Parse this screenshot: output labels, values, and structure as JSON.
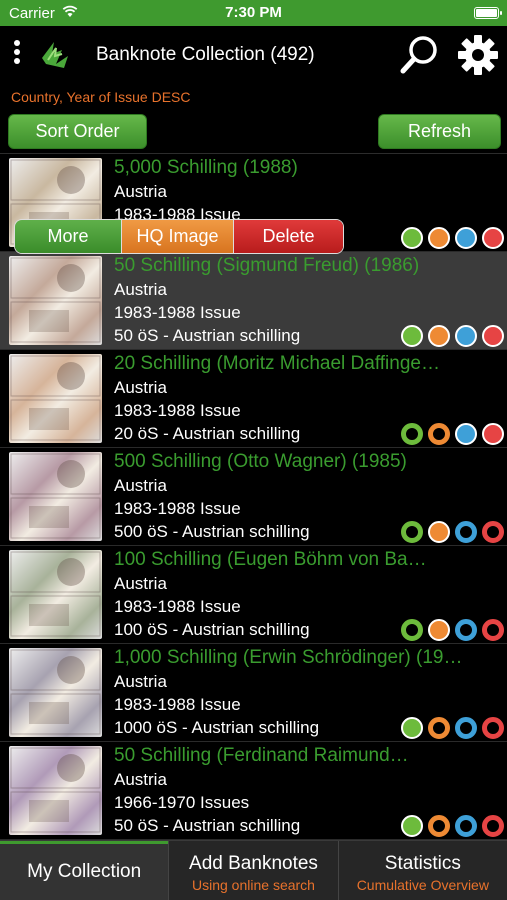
{
  "status": {
    "carrier": "Carrier",
    "time": "7:30 PM"
  },
  "nav": {
    "title": "Banknote Collection (492)"
  },
  "sort": {
    "label": "Country, Year of Issue DESC",
    "sort_button": "Sort Order",
    "refresh_button": "Refresh"
  },
  "actions": {
    "more": "More",
    "hq": "HQ Image",
    "delete": "Delete"
  },
  "items": [
    {
      "title": "5,000 Schilling (1988)",
      "country": "Austria",
      "issue": "1983-1988 Issue",
      "denom": "",
      "dots": [
        "green",
        "orange",
        "blue",
        "red"
      ]
    },
    {
      "title": "50 Schilling (Sigmund Freud) (1986)",
      "country": "Austria",
      "issue": "1983-1988 Issue",
      "denom": "50 öS - Austrian schilling",
      "dots": [
        "green",
        "orange",
        "blue",
        "red"
      ]
    },
    {
      "title": "20 Schilling (Moritz Michael Daffinge…",
      "country": "Austria",
      "issue": "1983-1988 Issue",
      "denom": "20 öS - Austrian schilling",
      "dots": [
        "hollow",
        "hollow-orange",
        "blue",
        "red"
      ]
    },
    {
      "title": "500 Schilling (Otto Wagner) (1985)",
      "country": "Austria",
      "issue": "1983-1988 Issue",
      "denom": "500 öS - Austrian schilling",
      "dots": [
        "hollow",
        "orange",
        "hollow-blue",
        "hollow-red"
      ]
    },
    {
      "title": "100 Schilling (Eugen Böhm von Ba…",
      "country": "Austria",
      "issue": "1983-1988 Issue",
      "denom": "100 öS - Austrian schilling",
      "dots": [
        "hollow",
        "orange",
        "hollow-blue",
        "hollow-red"
      ]
    },
    {
      "title": "1,000 Schilling (Erwin Schrödinger) (19…",
      "country": "Austria",
      "issue": "1983-1988 Issue",
      "denom": "1000 öS - Austrian schilling",
      "dots": [
        "green",
        "hollow-orange",
        "hollow-blue",
        "hollow-red"
      ]
    },
    {
      "title": "50 Schilling (Ferdinand Raimund…",
      "country": "Austria",
      "issue": "1966-1970 Issues",
      "denom": "50 öS - Austrian schilling",
      "dots": [
        "green",
        "hollow-orange",
        "hollow-blue",
        "hollow-red"
      ]
    }
  ],
  "tabs": [
    {
      "label": "My Collection",
      "sub": ""
    },
    {
      "label": "Add Banknotes",
      "sub": "Using online search"
    },
    {
      "label": "Statistics",
      "sub": "Cumulative Overview"
    }
  ],
  "colors": {
    "accent_green": "#3f9a2f",
    "title_green": "#3a9c2f",
    "orange": "#e8722c"
  },
  "thumb_colors": [
    "#c9b8a0",
    "#c4a99a",
    "#d6b49a",
    "#b79aa5",
    "#a8b29a",
    "#a7a2b0",
    "#b09ab8"
  ]
}
